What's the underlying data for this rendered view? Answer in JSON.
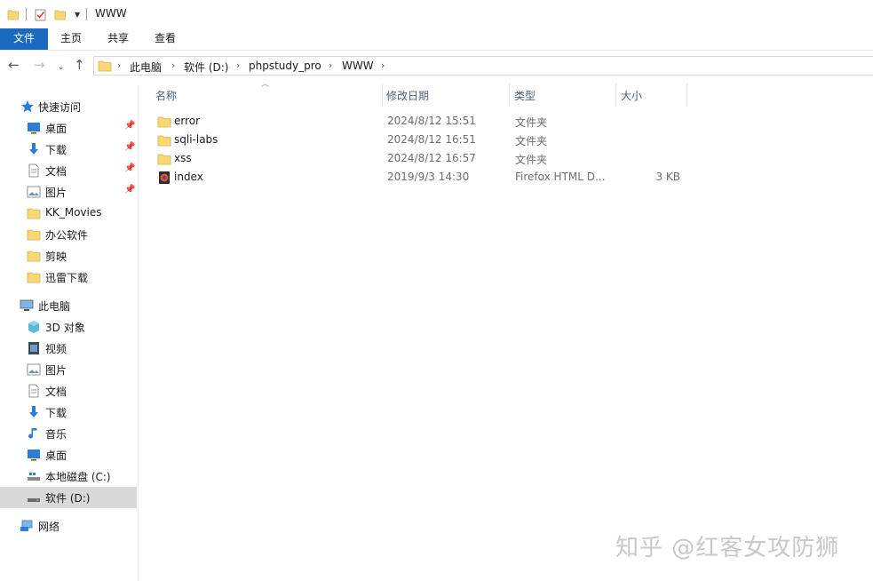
{
  "window": {
    "title": "WWW"
  },
  "ribbon": {
    "tabs": [
      "文件",
      "主页",
      "共享",
      "查看"
    ]
  },
  "address": {
    "crumbs": [
      "此电脑",
      "软件 (D:)",
      "phpstudy_pro",
      "WWW"
    ]
  },
  "sidebar": {
    "quick_access": {
      "label": "快速访问",
      "items": [
        {
          "label": "桌面",
          "icon": "desktop-icon",
          "pinned": true
        },
        {
          "label": "下载",
          "icon": "download-icon",
          "pinned": true
        },
        {
          "label": "文档",
          "icon": "document-icon",
          "pinned": true
        },
        {
          "label": "图片",
          "icon": "picture-icon",
          "pinned": true
        },
        {
          "label": "KK_Movies",
          "icon": "folder-icon",
          "pinned": false
        },
        {
          "label": "办公软件",
          "icon": "folder-icon",
          "pinned": false
        },
        {
          "label": "剪映",
          "icon": "folder-icon",
          "pinned": false
        },
        {
          "label": "迅雷下载",
          "icon": "folder-icon",
          "pinned": false
        }
      ]
    },
    "this_pc": {
      "label": "此电脑",
      "items": [
        {
          "label": "3D 对象",
          "icon": "3d-objects-icon"
        },
        {
          "label": "视频",
          "icon": "video-icon"
        },
        {
          "label": "图片",
          "icon": "picture-icon"
        },
        {
          "label": "文档",
          "icon": "document-icon"
        },
        {
          "label": "下载",
          "icon": "download-icon"
        },
        {
          "label": "音乐",
          "icon": "music-icon"
        },
        {
          "label": "桌面",
          "icon": "desktop-icon"
        },
        {
          "label": "本地磁盘 (C:)",
          "icon": "drive-c-icon"
        },
        {
          "label": "软件 (D:)",
          "icon": "drive-d-icon",
          "selected": true
        }
      ]
    },
    "network": {
      "label": "网络"
    }
  },
  "columns": {
    "name": "名称",
    "date": "修改日期",
    "type": "类型",
    "size": "大小"
  },
  "files": [
    {
      "name": "error",
      "date": "2024/8/12 15:51",
      "type": "文件夹",
      "size": "",
      "icon": "folder-icon"
    },
    {
      "name": "sqli-labs",
      "date": "2024/8/12 16:51",
      "type": "文件夹",
      "size": "",
      "icon": "folder-icon"
    },
    {
      "name": "xss",
      "date": "2024/8/12 16:57",
      "type": "文件夹",
      "size": "",
      "icon": "folder-icon"
    },
    {
      "name": "index",
      "date": "2019/9/3 14:30",
      "type": "Firefox HTML D...",
      "size": "3 KB",
      "icon": "firefox-html-icon"
    }
  ],
  "watermark": "知乎 @红客女攻防狮",
  "colors": {
    "accent": "#1a6bbf",
    "folder": "#f8d775",
    "selected_bg": "#d9d9d9"
  }
}
